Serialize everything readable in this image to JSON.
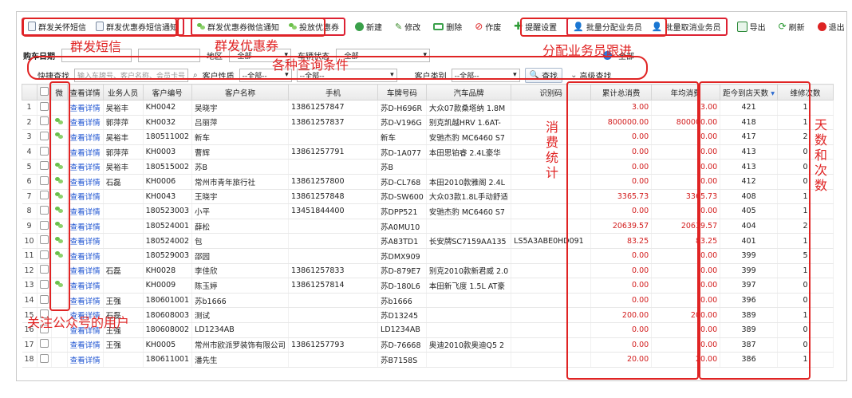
{
  "toolbar": {
    "sms_care": "群发关怀短信",
    "sms_coupon": "群发优惠券短信通知",
    "wx_coupon": "群发优惠券微信通知",
    "issue_coupon": "投放优惠券",
    "add": "新建",
    "edit": "修改",
    "delete": "删除",
    "void": "作废",
    "reminder": "提醒设置",
    "assign_staff": "批量分配业务员",
    "unassign_staff": "批量取消业务员",
    "export": "导出",
    "refresh": "刷新",
    "exit": "退出"
  },
  "filters": {
    "purchase_date_label": "购车日期",
    "region_label": "地区",
    "region_value": "--全部--",
    "vehicle_status_label": "车辆状态",
    "vehicle_status_value": "--全部--",
    "all_label": "全部",
    "quick_search_label": "快捷查找",
    "quick_search_placeholder": "输入车牌号、客户名称、会员卡号",
    "customer_nature_label": "客户性质",
    "customer_nature_value": "--全部--",
    "customer_nature2_value": "--全部--",
    "customer_type_label": "客户类别",
    "customer_type_value": "--全部--",
    "search_btn": "查找",
    "advanced_btn": "高级查找"
  },
  "table": {
    "headers": [
      "",
      "",
      "微",
      "查看详情",
      "业务人员",
      "客户编号",
      "客户名称",
      "手机",
      "车牌号码",
      "汽车品牌",
      "识别码",
      "累计总消费",
      "年均消费",
      "距今到店天数",
      "维修次数"
    ],
    "rows": [
      {
        "n": "1",
        "wx": false,
        "detail": "查看详情",
        "staff": "吴裕丰",
        "code": "KH0042",
        "name": "吴晓宇",
        "phone": "13861257847",
        "plate": "苏D-H696R",
        "brand": "大众07款桑塔纳 1.8M",
        "vin": "",
        "total": "3.00",
        "avg": "3.00",
        "days": "421",
        "times": "1"
      },
      {
        "n": "2",
        "wx": true,
        "detail": "查看详情",
        "staff": "郭萍萍",
        "code": "KH0032",
        "name": "吕丽萍",
        "phone": "13861257837",
        "plate": "苏D-V196G",
        "brand": "别克凯越HRV 1.6AT-",
        "vin": "",
        "total": "800000.00",
        "avg": "800000.00",
        "days": "418",
        "times": "1"
      },
      {
        "n": "3",
        "wx": true,
        "detail": "查看详情",
        "staff": "吴裕丰",
        "code": "180511002",
        "name": "新车",
        "phone": "",
        "plate": "新车",
        "brand": "安驰杰豹 MC6460 S7",
        "vin": "",
        "total": "0.00",
        "avg": "0.00",
        "days": "417",
        "times": "2"
      },
      {
        "n": "4",
        "wx": false,
        "detail": "查看详情",
        "staff": "郭萍萍",
        "code": "KH0003",
        "name": "曹辉",
        "phone": "13861257791",
        "plate": "苏D-1A077",
        "brand": "本田思铂睿 2.4L豪华",
        "vin": "",
        "total": "0.00",
        "avg": "0.00",
        "days": "413",
        "times": "0"
      },
      {
        "n": "5",
        "wx": true,
        "detail": "查看详情",
        "staff": "吴裕丰",
        "code": "180515002",
        "name": "苏B",
        "phone": "",
        "plate": "苏B",
        "brand": "",
        "vin": "",
        "total": "0.00",
        "avg": "0.00",
        "days": "413",
        "times": "0"
      },
      {
        "n": "6",
        "wx": true,
        "detail": "查看详情",
        "staff": "石磊",
        "code": "KH0006",
        "name": "常州市青年旅行社",
        "phone": "13861257800",
        "plate": "苏D-CL768",
        "brand": "本田2010款雅阁 2.4L",
        "vin": "",
        "total": "0.00",
        "avg": "0.00",
        "days": "412",
        "times": "0"
      },
      {
        "n": "7",
        "wx": true,
        "detail": "查看详情",
        "staff": "",
        "code": "KH0043",
        "name": "王晓宇",
        "phone": "13861257848",
        "plate": "苏D-SW600",
        "brand": "大众03款1.8L手动舒适",
        "vin": "",
        "total": "3365.73",
        "avg": "3365.73",
        "days": "408",
        "times": "1"
      },
      {
        "n": "8",
        "wx": true,
        "detail": "查看详情",
        "staff": "",
        "code": "180523003",
        "name": "小平",
        "phone": "13451844400",
        "plate": "苏DPP521",
        "brand": "安驰杰豹 MC6460 S7",
        "vin": "",
        "total": "0.00",
        "avg": "0.00",
        "days": "405",
        "times": "1"
      },
      {
        "n": "9",
        "wx": true,
        "detail": "查看详情",
        "staff": "",
        "code": "180524001",
        "name": "薛松",
        "phone": "",
        "plate": "苏A0MU10",
        "brand": "",
        "vin": "",
        "total": "20639.57",
        "avg": "20639.57",
        "days": "404",
        "times": "2"
      },
      {
        "n": "10",
        "wx": true,
        "detail": "查看详情",
        "staff": "",
        "code": "180524002",
        "name": "包",
        "phone": "",
        "plate": "苏A83TD1",
        "brand": "长安牌SC7159AA135",
        "vin": "LS5A3ABE0HD091",
        "total": "83.25",
        "avg": "83.25",
        "days": "401",
        "times": "1"
      },
      {
        "n": "11",
        "wx": true,
        "detail": "查看详情",
        "staff": "",
        "code": "180529003",
        "name": "邵园",
        "phone": "",
        "plate": "苏DMX909",
        "brand": "",
        "vin": "",
        "total": "0.00",
        "avg": "0.00",
        "days": "399",
        "times": "5"
      },
      {
        "n": "12",
        "wx": false,
        "detail": "查看详情",
        "staff": "石磊",
        "code": "KH0028",
        "name": "李佳欣",
        "phone": "13861257833",
        "plate": "苏D-879E7",
        "brand": "别克2010款新君威 2.0",
        "vin": "",
        "total": "0.00",
        "avg": "0.00",
        "days": "399",
        "times": "1"
      },
      {
        "n": "13",
        "wx": true,
        "detail": "查看详情",
        "staff": "",
        "code": "KH0009",
        "name": "陈玉婷",
        "phone": "13861257814",
        "plate": "苏D-180L6",
        "brand": "本田新飞度 1.5L AT豪",
        "vin": "",
        "total": "0.00",
        "avg": "0.00",
        "days": "397",
        "times": "0"
      },
      {
        "n": "14",
        "wx": false,
        "detail": "查看详情",
        "staff": "王强",
        "code": "180601001",
        "name": "苏b1666",
        "phone": "",
        "plate": "苏b1666",
        "brand": "",
        "vin": "",
        "total": "0.00",
        "avg": "0.00",
        "days": "396",
        "times": "0"
      },
      {
        "n": "15",
        "wx": false,
        "detail": "查看详情",
        "staff": "石磊",
        "code": "180608003",
        "name": "测试",
        "phone": "",
        "plate": "苏D13245",
        "brand": "",
        "vin": "",
        "total": "200.00",
        "avg": "200.00",
        "days": "389",
        "times": "1"
      },
      {
        "n": "16",
        "wx": false,
        "detail": "查看详情",
        "staff": "王强",
        "code": "180608002",
        "name": "LD1234AB",
        "phone": "",
        "plate": "LD1234AB",
        "brand": "",
        "vin": "",
        "total": "0.00",
        "avg": "0.00",
        "days": "389",
        "times": "0"
      },
      {
        "n": "17",
        "wx": false,
        "detail": "查看详情",
        "staff": "王强",
        "code": "KH0005",
        "name": "常州市欧派罗装饰有限公司",
        "phone": "13861257793",
        "plate": "苏D-76668",
        "brand": "奥迪2010款奥迪Q5 2",
        "vin": "",
        "total": "0.00",
        "avg": "0.00",
        "days": "387",
        "times": "0"
      },
      {
        "n": "18",
        "wx": false,
        "detail": "查看详情",
        "staff": "",
        "code": "180611001",
        "name": "潘先生",
        "phone": "",
        "plate": "苏B7158S",
        "brand": "",
        "vin": "",
        "total": "20.00",
        "avg": "20.00",
        "days": "386",
        "times": "1"
      }
    ]
  },
  "annotations": {
    "group_sms": "群发短信",
    "group_coupon": "群发优惠券",
    "assign_follow": "分配业务员跟进",
    "query_conditions": "各种查询条件",
    "consumption_stats": "消费统计",
    "days_and_times": "天数和次数",
    "followed_users": "关注公众号的用户"
  },
  "colors": {
    "annotation": "#e02424",
    "money": "#d21b1b",
    "link": "#1b52d1",
    "wechat": "#6abf4b"
  }
}
